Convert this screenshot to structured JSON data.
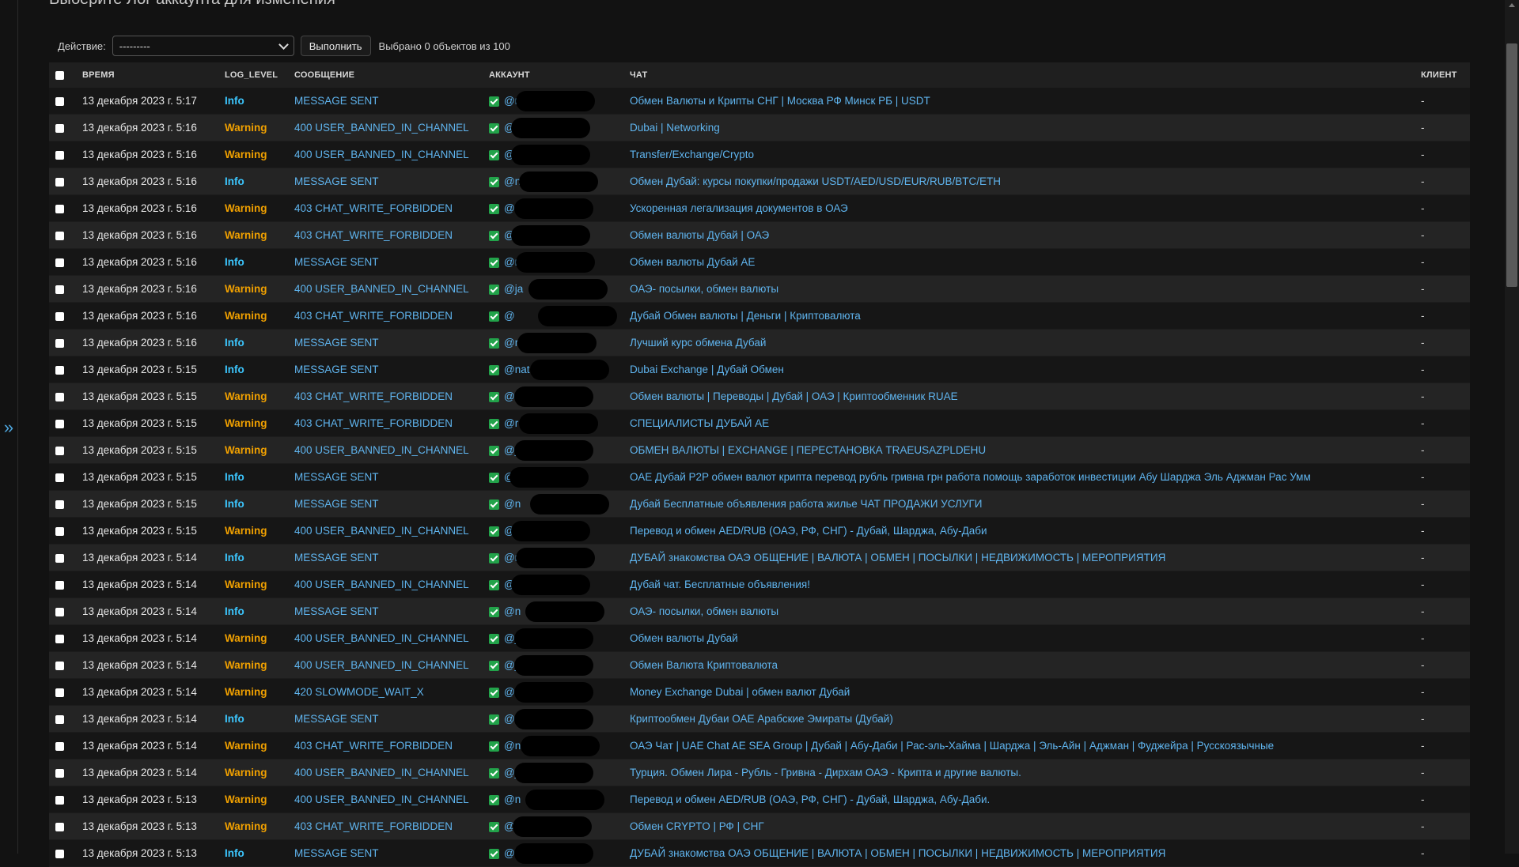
{
  "page": {
    "title": "Выберите Лог аккаунта для изменения"
  },
  "sidebar": {
    "toggle_label": "»"
  },
  "actions": {
    "label": "Действие:",
    "selected": "---------",
    "run_label": "Выполнить",
    "counter": "Выбрано 0 объектов из 100"
  },
  "table": {
    "headers": {
      "time": "Время",
      "log_level": "LOG_LEVEL",
      "message": "Сообщение",
      "account": "Аккаунт",
      "chat": "Чат",
      "client": "Клиент"
    },
    "rows": [
      {
        "time": "13 декабря 2023 г. 5:17",
        "level": "Info",
        "message": "MESSAGE SENT",
        "account": "@nat",
        "chat": "Обмен Валюты и Крипты СНГ | Москва РФ Минск РБ | USDT",
        "client": "-"
      },
      {
        "time": "13 декабря 2023 г. 5:16",
        "level": "Warning",
        "message": "400 USER_BANNED_IN_CHANNEL",
        "account": "@",
        "chat": "Dubai | Networking",
        "client": "-"
      },
      {
        "time": "13 декабря 2023 г. 5:16",
        "level": "Warning",
        "message": "400 USER_BANNED_IN_CHANNEL",
        "account": "@",
        "chat": "Transfer/Exchange/Crypto",
        "client": "-"
      },
      {
        "time": "13 декабря 2023 г. 5:16",
        "level": "Info",
        "message": "MESSAGE SENT",
        "account": "@na",
        "chat": "Обмен Дубай: курсы покупки/продажи USDT/AED/USD/EUR/RUB/BTC/ETH",
        "client": "-"
      },
      {
        "time": "13 декабря 2023 г. 5:16",
        "level": "Warning",
        "message": "403 CHAT_WRITE_FORBIDDEN",
        "account": "@n",
        "chat": "Ускоренная легализация документов в ОАЭ",
        "client": "-"
      },
      {
        "time": "13 декабря 2023 г. 5:16",
        "level": "Warning",
        "message": "403 CHAT_WRITE_FORBIDDEN",
        "account": "@j",
        "chat": "Обмен валюты Дубай | ОАЭ",
        "client": "-"
      },
      {
        "time": "13 декабря 2023 г. 5:16",
        "level": "Info",
        "message": "MESSAGE SENT",
        "account": "@ni",
        "chat": "Обмен валюты Дубай AE",
        "client": "-"
      },
      {
        "time": "13 декабря 2023 г. 5:16",
        "level": "Warning",
        "message": "400 USER_BANNED_IN_CHANNEL",
        "account": "@ja",
        "chat": "ОАЭ- посылки, обмен валюты",
        "client": "-"
      },
      {
        "time": "13 декабря 2023 г. 5:16",
        "level": "Warning",
        "message": "403 CHAT_WRITE_FORBIDDEN",
        "account": "@",
        "chat": "Дубай Обмен валюты | Деньги | Криптовалюта",
        "client": "-"
      },
      {
        "time": "13 декабря 2023 г. 5:16",
        "level": "Info",
        "message": "MESSAGE SENT",
        "account": "@ni",
        "chat": "Лучший курс обмена Дубай",
        "client": "-"
      },
      {
        "time": "13 декабря 2023 г. 5:15",
        "level": "Info",
        "message": "MESSAGE SENT",
        "account": "@nat",
        "chat": "Dubai Exchange | Дубай Обмен",
        "client": "-"
      },
      {
        "time": "13 декабря 2023 г. 5:15",
        "level": "Warning",
        "message": "403 CHAT_WRITE_FORBIDDEN",
        "account": "@",
        "chat": "Обмен валюты | Переводы | Дубай | ОАЭ | Криптообменник RUAE",
        "client": "-"
      },
      {
        "time": "13 декабря 2023 г. 5:15",
        "level": "Warning",
        "message": "403 CHAT_WRITE_FORBIDDEN",
        "account": "@r",
        "chat": "СПЕЦИАЛИСТЫ ДУБАЙ AE",
        "client": "-"
      },
      {
        "time": "13 декабря 2023 г. 5:15",
        "level": "Warning",
        "message": "400 USER_BANNED_IN_CHANNEL",
        "account": "@ja",
        "chat": "ОБМЕН ВАЛЮТЫ | EXCHANGE | ПЕРЕСТАНОВКА TRAEUSAZPLDEHU",
        "client": "-"
      },
      {
        "time": "13 декабря 2023 г. 5:15",
        "level": "Info",
        "message": "MESSAGE SENT",
        "account": "@nik",
        "chat": "ОАЕ Дубай P2P обмен валют крипта перевод рубль гривна грн работа помощь заработок инвестиции Абу Шарджа Эль Аджман Рас Умм",
        "client": "-"
      },
      {
        "time": "13 декабря 2023 г. 5:15",
        "level": "Info",
        "message": "MESSAGE SENT",
        "account": "@n",
        "chat": "Дубай Бесплатные объявления работа жилье ЧАТ ПРОДАЖИ УСЛУГИ",
        "client": "-"
      },
      {
        "time": "13 декабря 2023 г. 5:15",
        "level": "Warning",
        "message": "400 USER_BANNED_IN_CHANNEL",
        "account": "@j",
        "chat": "Перевод и обмен AED/RUB (ОАЭ, РФ, СНГ) - Дубай, Шарджа, Абу-Даби",
        "client": "-"
      },
      {
        "time": "13 декабря 2023 г. 5:14",
        "level": "Info",
        "message": "MESSAGE SENT",
        "account": "@ni",
        "chat": "ДУБАЙ знакомства ОАЭ ОБЩЕНИЕ | ВАЛЮТА | ОБМЕН | ПОСЫЛКИ | НЕДВИЖИМОСТЬ | МЕРОПРИЯТИЯ",
        "client": "-"
      },
      {
        "time": "13 декабря 2023 г. 5:14",
        "level": "Warning",
        "message": "400 USER_BANNED_IN_CHANNEL",
        "account": "@ja",
        "chat": "Дубай чат. Бесплатные объявления!",
        "client": "-"
      },
      {
        "time": "13 декабря 2023 г. 5:14",
        "level": "Info",
        "message": "MESSAGE SENT",
        "account": "@n",
        "chat": "ОАЭ- посылки, обмен валюты",
        "client": "-"
      },
      {
        "time": "13 декабря 2023 г. 5:14",
        "level": "Warning",
        "message": "400 USER_BANNED_IN_CHANNEL",
        "account": "@ja",
        "chat": "Обмен валюты Дубай",
        "client": "-"
      },
      {
        "time": "13 декабря 2023 г. 5:14",
        "level": "Warning",
        "message": "400 USER_BANNED_IN_CHANNEL",
        "account": "@ja",
        "chat": "Обмен Валюта Криптовалюта",
        "client": "-"
      },
      {
        "time": "13 декабря 2023 г. 5:14",
        "level": "Warning",
        "message": "420 SLOWMODE_WAIT_X",
        "account": "@nat",
        "chat": "Money Exchange Dubai | обмен валют Дубай",
        "client": "-"
      },
      {
        "time": "13 декабря 2023 г. 5:14",
        "level": "Info",
        "message": "MESSAGE SENT",
        "account": "@ni",
        "chat": "Криптообмен Дубаи ОАЕ Арабские Эмираты (Дубай)",
        "client": "-"
      },
      {
        "time": "13 декабря 2023 г. 5:14",
        "level": "Warning",
        "message": "403 CHAT_WRITE_FORBIDDEN",
        "account": "@n",
        "chat": "ОАЭ Чат | UAE Chat AE SEA Group | Дубай | Абу-Даби | Рас-эль-Хайма | Шарджа | Эль-Айн | Аджман | Фуджейра | Русскоязычные",
        "client": "-"
      },
      {
        "time": "13 декабря 2023 г. 5:14",
        "level": "Warning",
        "message": "400 USER_BANNED_IN_CHANNEL",
        "account": "@ja",
        "chat": "Турция. Обмен Лира - Рубль - Гривна - Дирхам ОАЭ - Крипта и другие валюты.",
        "client": "-"
      },
      {
        "time": "13 декабря 2023 г. 5:13",
        "level": "Warning",
        "message": "400 USER_BANNED_IN_CHANNEL",
        "account": "@n",
        "chat": "Перевод и обмен AED/RUB (ОАЭ, РФ, СНГ) - Дубай, Шарджа, Абу-Даби.",
        "client": "-"
      },
      {
        "time": "13 декабря 2023 г. 5:13",
        "level": "Warning",
        "message": "403 CHAT_WRITE_FORBIDDEN",
        "account": "@ja",
        "chat": "Обмен CRYPTO | РФ | СНГ",
        "client": "-"
      },
      {
        "time": "13 декабря 2023 г. 5:13",
        "level": "Info",
        "message": "MESSAGE SENT",
        "account": "@nat",
        "chat": "ДУБАЙ знакомства ОАЭ ОБЩЕНИЕ | ВАЛЮТА | ОБМЕН | ПОСЫЛКИ | НЕДВИЖИМОСТЬ | МЕРОПРИЯТИЯ",
        "client": "-"
      }
    ]
  }
}
